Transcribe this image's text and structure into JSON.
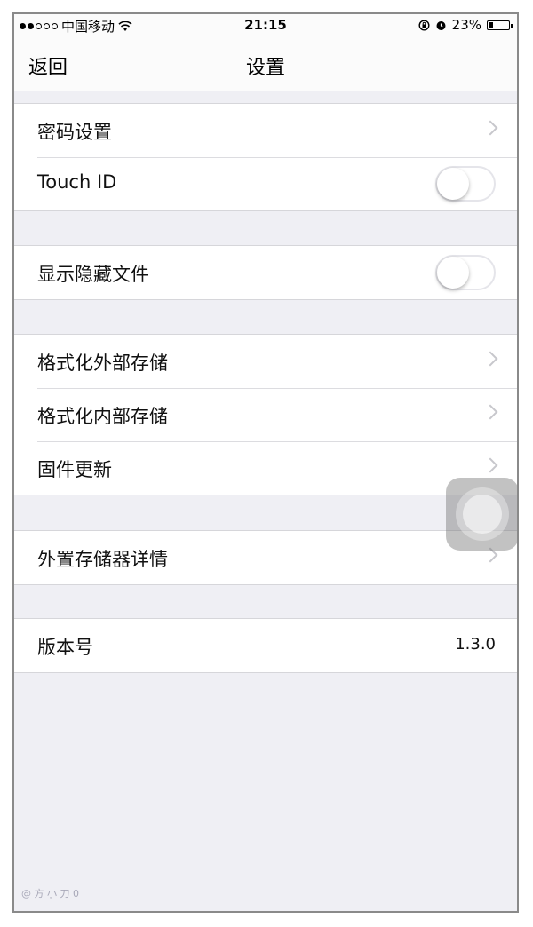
{
  "status_bar": {
    "carrier": "中国移动",
    "time": "21:15",
    "battery": "23%",
    "battery_level": 0.23
  },
  "nav": {
    "back_label": "返回",
    "title": "设置"
  },
  "groups": [
    {
      "rows": [
        {
          "label": "密码设置",
          "accessory": "chevron"
        },
        {
          "label": "Touch ID",
          "accessory": "toggle",
          "on": false
        }
      ]
    },
    {
      "rows": [
        {
          "label": "显示隐藏文件",
          "accessory": "toggle",
          "on": false
        }
      ]
    },
    {
      "rows": [
        {
          "label": "格式化外部存储",
          "accessory": "chevron"
        },
        {
          "label": "格式化内部存储",
          "accessory": "chevron"
        },
        {
          "label": "固件更新",
          "accessory": "chevron"
        }
      ]
    },
    {
      "rows": [
        {
          "label": "外置存储器详情",
          "accessory": "chevron"
        }
      ]
    },
    {
      "rows": [
        {
          "label": "版本号",
          "accessory": "value",
          "value": "1.3.0"
        }
      ]
    }
  ],
  "watermark": "@ 方 小 刀 0"
}
